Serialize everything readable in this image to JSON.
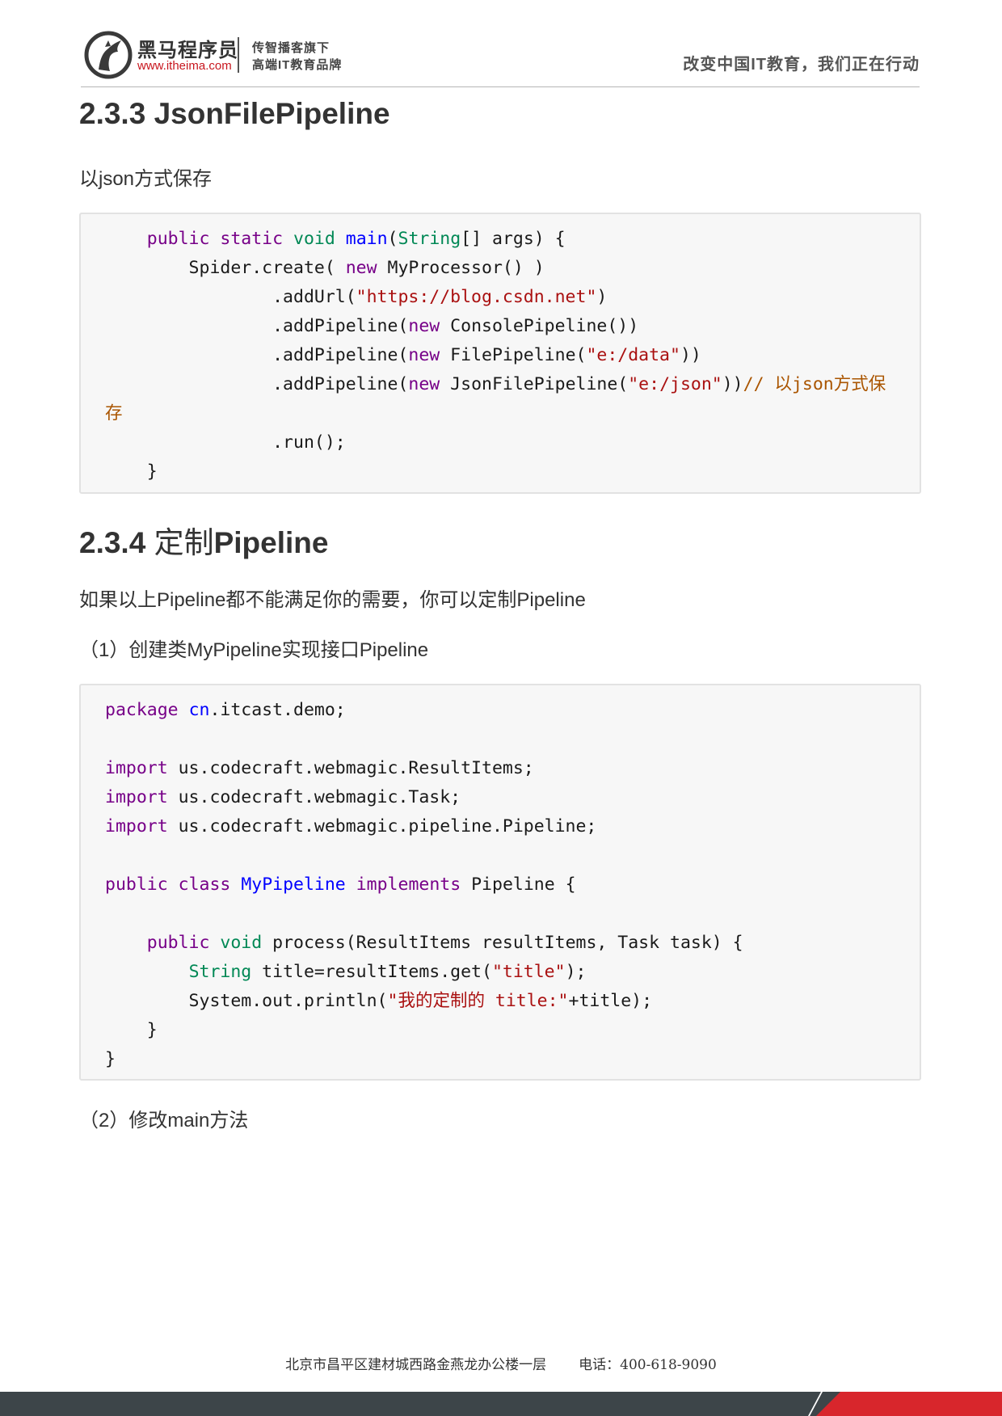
{
  "header": {
    "brand_name": "黑马程序员",
    "brand_url": "www.itheima.com",
    "slogan_line1": "传智播客旗下",
    "slogan_line2": "高端IT教育品牌",
    "motto": "改变中国IT教育，我们正在行动"
  },
  "section_233": {
    "number": "2.3.3",
    "title": "JsonFilePipeline",
    "description": "以json方式保存"
  },
  "section_234": {
    "number": "2.3.4",
    "title_prefix": "定制",
    "title_suffix": "Pipeline",
    "description": "如果以上Pipeline都不能满足你的需要，你可以定制Pipeline",
    "step1": "（1）创建类MyPipeline实现接口Pipeline",
    "step2": "（2）修改main方法"
  },
  "code_main": [
    [
      [
        "    ",
        ""
      ],
      [
        "public",
        "kw"
      ],
      [
        " ",
        ""
      ],
      [
        "static",
        "kw"
      ],
      [
        " ",
        ""
      ],
      [
        "void",
        "ty"
      ],
      [
        " ",
        ""
      ],
      [
        "main",
        "def"
      ],
      [
        "(",
        ""
      ],
      [
        "String",
        "ty"
      ],
      [
        "[] args) {",
        ""
      ]
    ],
    [
      [
        "        Spider.create( ",
        ""
      ],
      [
        "new",
        "kw"
      ],
      [
        " MyProcessor() )",
        ""
      ]
    ],
    [
      [
        "                .addUrl(",
        ""
      ],
      [
        "\"https://blog.csdn.net\"",
        "str"
      ],
      [
        ")",
        ""
      ]
    ],
    [
      [
        "                .addPipeline(",
        ""
      ],
      [
        "new",
        "kw"
      ],
      [
        " ConsolePipeline())",
        ""
      ]
    ],
    [
      [
        "                .addPipeline(",
        ""
      ],
      [
        "new",
        "kw"
      ],
      [
        " FilePipeline(",
        ""
      ],
      [
        "\"e:/data\"",
        "str"
      ],
      [
        "))",
        ""
      ]
    ],
    [
      [
        "                .addPipeline(",
        ""
      ],
      [
        "new",
        "kw"
      ],
      [
        " JsonFilePipeline(",
        ""
      ],
      [
        "\"e:/json\"",
        "str"
      ],
      [
        "))",
        ""
      ],
      [
        "// 以json方式保",
        "cm"
      ]
    ],
    [
      [
        "存",
        "cm"
      ]
    ],
    [
      [
        "                .run();",
        ""
      ]
    ],
    [
      [
        "    }",
        ""
      ]
    ]
  ],
  "code_pipeline": [
    [
      [
        "package",
        "kw"
      ],
      [
        " ",
        ""
      ],
      [
        "cn",
        "def"
      ],
      [
        ".itcast.demo;",
        ""
      ]
    ],
    [
      [
        "",
        ""
      ]
    ],
    [
      [
        "import",
        "kw"
      ],
      [
        " us.codecraft.webmagic.ResultItems;",
        ""
      ]
    ],
    [
      [
        "import",
        "kw"
      ],
      [
        " us.codecraft.webmagic.Task;",
        ""
      ]
    ],
    [
      [
        "import",
        "kw"
      ],
      [
        " us.codecraft.webmagic.pipeline.Pipeline;",
        ""
      ]
    ],
    [
      [
        "",
        ""
      ]
    ],
    [
      [
        "public",
        "kw"
      ],
      [
        " ",
        ""
      ],
      [
        "class",
        "kw"
      ],
      [
        " ",
        ""
      ],
      [
        "MyPipeline",
        "def"
      ],
      [
        " ",
        ""
      ],
      [
        "implements",
        "kw"
      ],
      [
        " Pipeline {",
        ""
      ]
    ],
    [
      [
        "",
        ""
      ]
    ],
    [
      [
        "    ",
        ""
      ],
      [
        "public",
        "kw"
      ],
      [
        " ",
        ""
      ],
      [
        "void",
        "ty"
      ],
      [
        " process(ResultItems resultItems, Task task) {",
        ""
      ]
    ],
    [
      [
        "        ",
        ""
      ],
      [
        "String",
        "ty"
      ],
      [
        " title=resultItems.get(",
        ""
      ],
      [
        "\"title\"",
        "str"
      ],
      [
        ");",
        ""
      ]
    ],
    [
      [
        "        System.out.println(",
        ""
      ],
      [
        "\"我的定制的 title:\"",
        "str"
      ],
      [
        "+title);",
        ""
      ]
    ],
    [
      [
        "    }",
        ""
      ]
    ],
    [
      [
        "}",
        ""
      ]
    ]
  ],
  "footer": {
    "address": "北京市昌平区建材城西路金燕龙办公楼一层",
    "phone": "电话：400-618-9090"
  },
  "colors": {
    "brand_red": "#d8262c",
    "footer_dark": "#3d4549",
    "code_background": "#f7f7f7"
  }
}
